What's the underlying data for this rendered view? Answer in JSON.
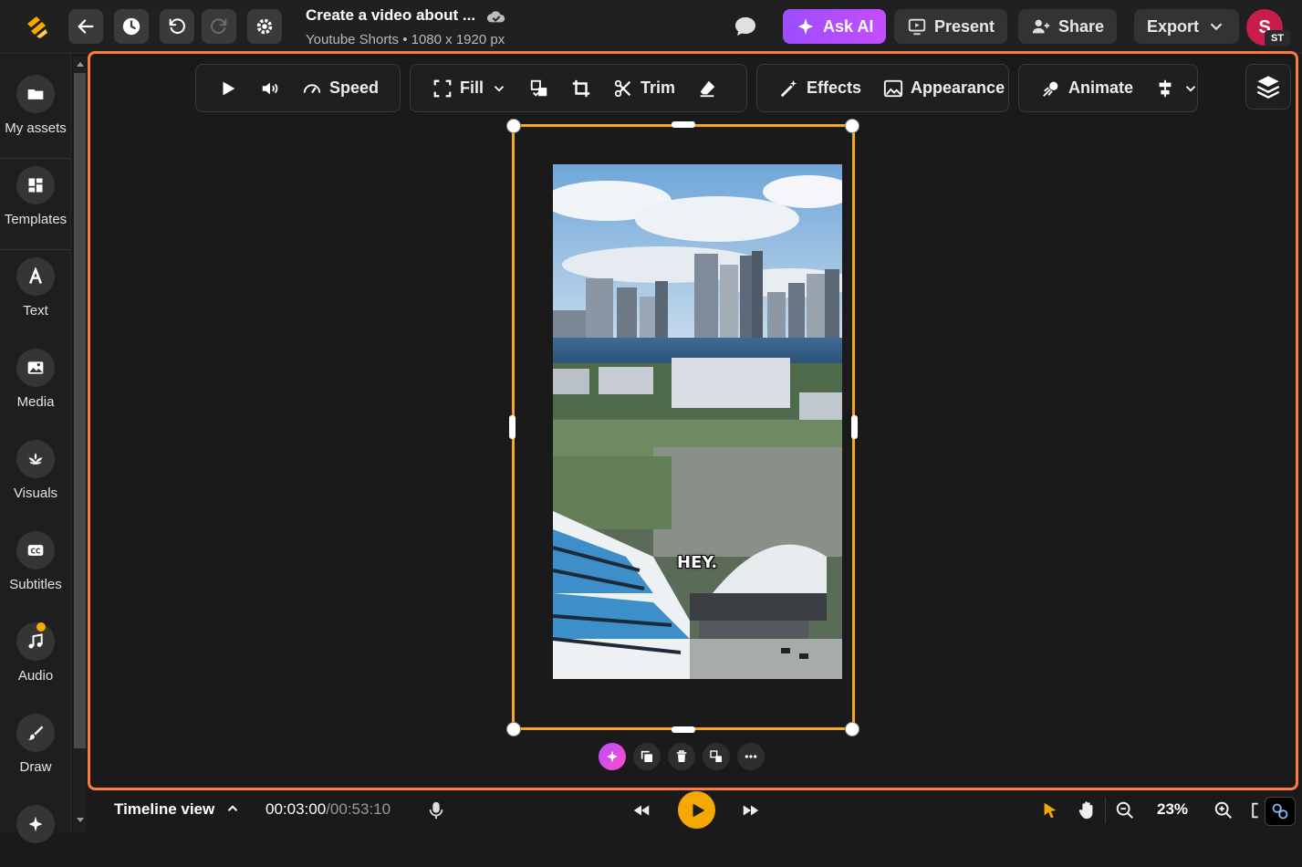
{
  "header": {
    "title": "Create a video about ...",
    "subtitle": "Youtube Shorts • 1080 x 1920 px",
    "ask_ai": "Ask AI",
    "present": "Present",
    "share": "Share",
    "export": "Export",
    "avatar_letter": "S",
    "avatar_badge": "ST"
  },
  "sidebar": {
    "items": [
      {
        "label": "My assets",
        "icon": "folder-icon"
      },
      {
        "label": "Templates",
        "icon": "templates-icon"
      },
      {
        "label": "Text",
        "icon": "text-icon"
      },
      {
        "label": "Media",
        "icon": "image-icon"
      },
      {
        "label": "Visuals",
        "icon": "visuals-icon"
      },
      {
        "label": "Subtitles",
        "icon": "cc-icon"
      },
      {
        "label": "Audio",
        "icon": "music-icon"
      },
      {
        "label": "Draw",
        "icon": "brush-icon"
      }
    ]
  },
  "toolbar": {
    "speed": "Speed",
    "fill": "Fill",
    "trim": "Trim",
    "effects": "Effects",
    "appearance": "Appearance",
    "animate": "Animate"
  },
  "canvas": {
    "caption": "HEY."
  },
  "bottom": {
    "timeline_label": "Timeline view",
    "current_time": "00:03:00",
    "total_time": "/00:53:10",
    "zoom": "23%"
  },
  "colors": {
    "accent_orange": "#ff7a3d",
    "selection": "#f5a623",
    "play": "#f5a800",
    "ask_ai": "#b44dff"
  }
}
